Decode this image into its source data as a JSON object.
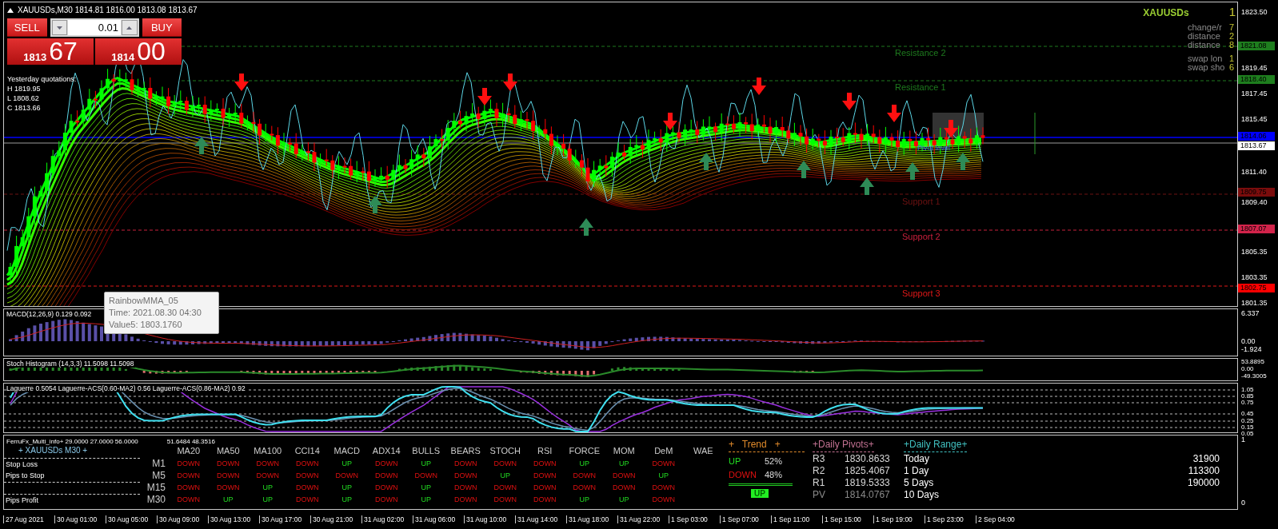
{
  "chart_header": {
    "text": "XAUUSDs,M30  1814.81 1816.00 1813.08 1813.67"
  },
  "trade_panel": {
    "sell": "SELL",
    "buy": "BUY",
    "lot": "0.01",
    "bid": {
      "figure": "1813",
      "pips": "67"
    },
    "ask": {
      "figure": "1814",
      "pips": "00"
    }
  },
  "yesterday": [
    "Yesterday quotations:",
    "H 1819.95",
    "L 1808.62",
    "C 1813.66"
  ],
  "levels": [
    {
      "label": "Resistance 2",
      "color": "#1e7a1e"
    },
    {
      "label": "Resistance 1",
      "color": "#1e7a1e"
    },
    {
      "label": "Support 1",
      "color": "#6e1212"
    },
    {
      "label": "Support 2",
      "color": "#c8203c"
    },
    {
      "label": "Support 3",
      "color": "#e01818"
    }
  ],
  "pivot_label": "Pivot level",
  "info_box": {
    "symbol": "XAUUSDs",
    "value": "1",
    "groups": [
      [
        {
          "label": "change/r",
          "value": "7"
        },
        {
          "label": "distance",
          "value": "2"
        },
        {
          "label": "distance",
          "value": "8"
        }
      ],
      [
        {
          "label": "swap lon",
          "value": "1"
        },
        {
          "label": "swap sho",
          "value": "6"
        }
      ]
    ]
  },
  "tooltip": {
    "lines": [
      "RainbowMMA_05",
      "Time: 2021.08.30 04:30",
      "Value5: 1803.1760"
    ]
  },
  "price_axis": [
    {
      "text": "1823.50",
      "kind": "tick"
    },
    {
      "text": "1821.08",
      "kind": "marker",
      "color": "#1e7e1e"
    },
    {
      "text": "1819.45",
      "kind": "tick"
    },
    {
      "text": "1818.40",
      "kind": "marker",
      "color": "#1e7e1e"
    },
    {
      "text": "1817.45",
      "kind": "tick"
    },
    {
      "text": "1815.45",
      "kind": "tick"
    },
    {
      "text": "1814.06",
      "kind": "marker",
      "color": "#0000ff"
    },
    {
      "text": "1813.67",
      "kind": "marker",
      "color": "#ffffff"
    },
    {
      "text": "1811.40",
      "kind": "tick"
    },
    {
      "text": "1809.75",
      "kind": "marker",
      "color": "#7a0c0c"
    },
    {
      "text": "1809.40",
      "kind": "tick"
    },
    {
      "text": "1807.07",
      "kind": "marker",
      "color": "#d2234a"
    },
    {
      "text": "1805.35",
      "kind": "tick"
    },
    {
      "text": "1803.35",
      "kind": "tick"
    },
    {
      "text": "1802.75",
      "kind": "marker",
      "color": "#ff0000"
    },
    {
      "text": "1801.35",
      "kind": "tick"
    }
  ],
  "macd": {
    "label": "MACD(12,26,9) 0.129 0.092",
    "axis": [
      "6.337",
      "0.00",
      "-1.924"
    ]
  },
  "stoch": {
    "label": "Stoch Histogram (14,3,3) 11.5098 11.5098",
    "axis": [
      "53.8895",
      "0.00",
      "-49.3005"
    ]
  },
  "laguerre": {
    "label": "Laguerre 0.5054  Laguerre-ACS(0.60-MA2) 0.56  Laguerre-ACS(0.86-MA2) 0.92",
    "axis": [
      "1.05",
      "0.85",
      "0.75",
      "0.45",
      "0.25",
      "0.15",
      "0.05"
    ]
  },
  "dashboard": {
    "title": "FerruFx_Multi_info+ 29.0000 27.0000 56.0000",
    "title_values": "51.6484 48.3516",
    "symbol": "+ XAUUSDs  M30 +",
    "side_labels": [
      "Stop Loss",
      "Pips to Stop",
      "Pips Profit"
    ],
    "columns": [
      "MA20",
      "MA50",
      "MA100",
      "CCI14",
      "MACD",
      "ADX14",
      "BULLS",
      "BEARS",
      "STOCH",
      "RSI",
      "FORCE",
      "MOM",
      "DeM",
      "WAE"
    ],
    "rows": [
      {
        "timeframe": "M1",
        "cells": [
          {
            "text": "DOWN",
            "kind": "down"
          },
          {
            "text": "DOWN",
            "kind": "down"
          },
          {
            "text": "DOWN",
            "kind": "down"
          },
          {
            "text": "DOWN",
            "kind": "down"
          },
          {
            "text": "UP",
            "kind": "up"
          },
          {
            "text": "DOWN",
            "kind": "down"
          },
          {
            "text": "UP",
            "kind": "up"
          },
          {
            "text": "DOWN",
            "kind": "down"
          },
          {
            "text": "DOWN",
            "kind": "down"
          },
          {
            "text": "DOWN",
            "kind": "down"
          },
          {
            "text": "UP",
            "kind": "up"
          },
          {
            "text": "UP",
            "kind": "up"
          },
          {
            "text": "DOWN",
            "kind": "down"
          }
        ]
      },
      {
        "timeframe": "M5",
        "cells": [
          {
            "text": "DOWN",
            "kind": "down"
          },
          {
            "text": "DOWN",
            "kind": "down"
          },
          {
            "text": "DOWN",
            "kind": "down"
          },
          {
            "text": "DOWN",
            "kind": "down"
          },
          {
            "text": "DOWN",
            "kind": "down"
          },
          {
            "text": "DOWN",
            "kind": "down"
          },
          {
            "text": "DOWN",
            "kind": "down"
          },
          {
            "text": "DOWN",
            "kind": "down"
          },
          {
            "text": "UP",
            "kind": "up"
          },
          {
            "text": "DOWN",
            "kind": "down"
          },
          {
            "text": "DOWN",
            "kind": "down"
          },
          {
            "text": "DOWN",
            "kind": "down"
          },
          {
            "text": "UP",
            "kind": "up"
          }
        ]
      },
      {
        "timeframe": "M15",
        "cells": [
          {
            "text": "DOWN",
            "kind": "down"
          },
          {
            "text": "DOWN",
            "kind": "down"
          },
          {
            "text": "UP",
            "kind": "up"
          },
          {
            "text": "DOWN",
            "kind": "down"
          },
          {
            "text": "UP",
            "kind": "up"
          },
          {
            "text": "DOWN",
            "kind": "down"
          },
          {
            "text": "UP",
            "kind": "up"
          },
          {
            "text": "DOWN",
            "kind": "down"
          },
          {
            "text": "DOWN",
            "kind": "down"
          },
          {
            "text": "DOWN",
            "kind": "down"
          },
          {
            "text": "DOWN",
            "kind": "down"
          },
          {
            "text": "DOWN",
            "kind": "down"
          },
          {
            "text": "DOWN",
            "kind": "down"
          }
        ]
      },
      {
        "timeframe": "M30",
        "cells": [
          {
            "text": "DOWN",
            "kind": "down"
          },
          {
            "text": "UP",
            "kind": "up"
          },
          {
            "text": "UP",
            "kind": "up"
          },
          {
            "text": "DOWN",
            "kind": "down"
          },
          {
            "text": "UP",
            "kind": "up"
          },
          {
            "text": "DOWN",
            "kind": "down"
          },
          {
            "text": "UP",
            "kind": "up"
          },
          {
            "text": "DOWN",
            "kind": "down"
          },
          {
            "text": "DOWN",
            "kind": "down"
          },
          {
            "text": "DOWN",
            "kind": "down"
          },
          {
            "text": "UP",
            "kind": "up"
          },
          {
            "text": "UP",
            "kind": "up"
          },
          {
            "text": "DOWN",
            "kind": "down"
          }
        ]
      }
    ],
    "trend": {
      "title": "+   Trend   +",
      "rows": [
        {
          "label": "UP",
          "value": "52%",
          "kind": "up"
        },
        {
          "label": "DOWN",
          "value": "48%",
          "kind": "down"
        }
      ],
      "badge": "UP"
    },
    "pivots": {
      "title": "+Daily Pivots+",
      "rows": [
        {
          "label": "R3",
          "value": "1830.8633",
          "kind": "resistance"
        },
        {
          "label": "R2",
          "value": "1825.4067",
          "kind": "resistance"
        },
        {
          "label": "R1",
          "value": "1819.5333",
          "kind": "resistance"
        },
        {
          "label": "PV",
          "value": "1814.0767",
          "kind": "pivot"
        }
      ]
    },
    "range": {
      "title": "+Daily Range+",
      "rows": [
        {
          "label": "Today",
          "value": "31900"
        },
        {
          "label": "1 Day",
          "value": "113300"
        },
        {
          "label": "5 Days",
          "value": "190000"
        },
        {
          "label": "10 Days"
        }
      ]
    },
    "axis": [
      "1",
      "0"
    ]
  },
  "time_axis": [
    "27 Aug 2021",
    "30 Aug 01:00",
    "30 Aug 05:00",
    "30 Aug 09:00",
    "30 Aug 13:00",
    "30 Aug 17:00",
    "30 Aug 21:00",
    "31 Aug 02:00",
    "31 Aug 06:00",
    "31 Aug 10:00",
    "31 Aug 14:00",
    "31 Aug 18:00",
    "31 Aug 22:00",
    "1 Sep 03:00",
    "1 Sep 07:00",
    "1 Sep 11:00",
    "1 Sep 15:00",
    "1 Sep 19:00",
    "1 Sep 23:00",
    "2 Sep 04:00"
  ]
}
